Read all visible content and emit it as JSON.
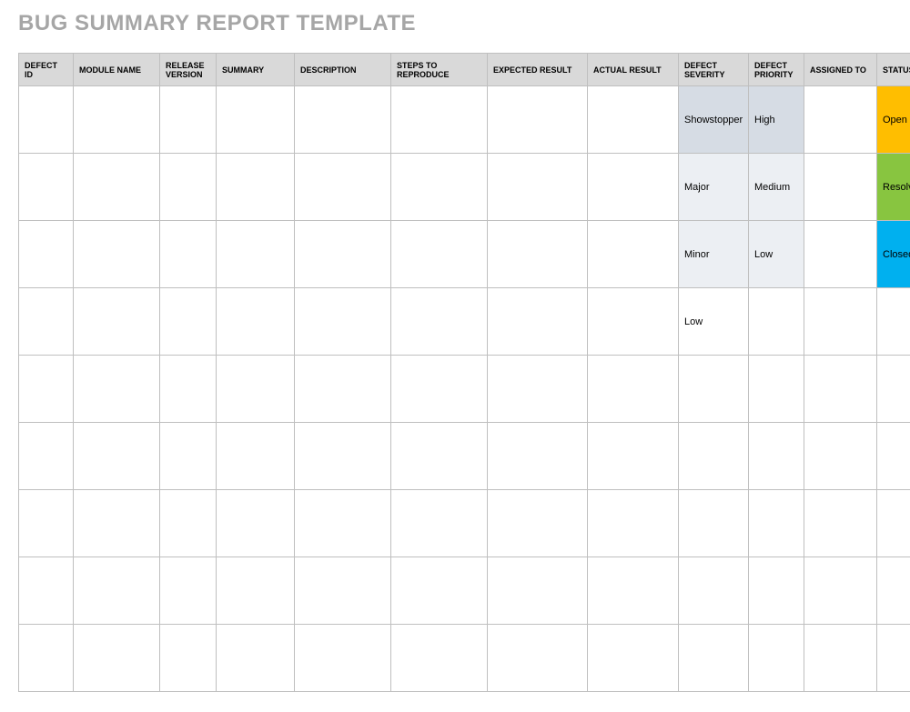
{
  "title": "BUG SUMMARY REPORT TEMPLATE",
  "columns": [
    "DEFECT ID",
    "MODULE NAME",
    "RELEASE VERSION",
    "SUMMARY",
    "DESCRIPTION",
    "STEPS TO REPRODUCE",
    "EXPECTED RESULT",
    "ACTUAL RESULT",
    "DEFECT SEVERITY",
    "DEFECT PRIORITY",
    "ASSIGNED TO",
    "STATUS"
  ],
  "rows": [
    {
      "severity": "Showstopper",
      "severity_class": "fill-grayblue",
      "priority": "High",
      "priority_class": "fill-grayblue",
      "status": "Open",
      "status_class": "fill-orange"
    },
    {
      "severity": "Major",
      "severity_class": "fill-lightblue",
      "priority": "Medium",
      "priority_class": "fill-lightblue",
      "status": "Resolved",
      "status_class": "fill-green"
    },
    {
      "severity": "Minor",
      "severity_class": "fill-lightblue",
      "priority": "Low",
      "priority_class": "fill-lightblue",
      "status": "Closed",
      "status_class": "fill-blue"
    },
    {
      "severity": "Low",
      "severity_class": "",
      "priority": "",
      "priority_class": "",
      "status": "",
      "status_class": ""
    },
    {
      "severity": "",
      "severity_class": "",
      "priority": "",
      "priority_class": "",
      "status": "",
      "status_class": ""
    },
    {
      "severity": "",
      "severity_class": "",
      "priority": "",
      "priority_class": "",
      "status": "",
      "status_class": ""
    },
    {
      "severity": "",
      "severity_class": "",
      "priority": "",
      "priority_class": "",
      "status": "",
      "status_class": ""
    },
    {
      "severity": "",
      "severity_class": "",
      "priority": "",
      "priority_class": "",
      "status": "",
      "status_class": ""
    },
    {
      "severity": "",
      "severity_class": "",
      "priority": "",
      "priority_class": "",
      "status": "",
      "status_class": ""
    }
  ]
}
